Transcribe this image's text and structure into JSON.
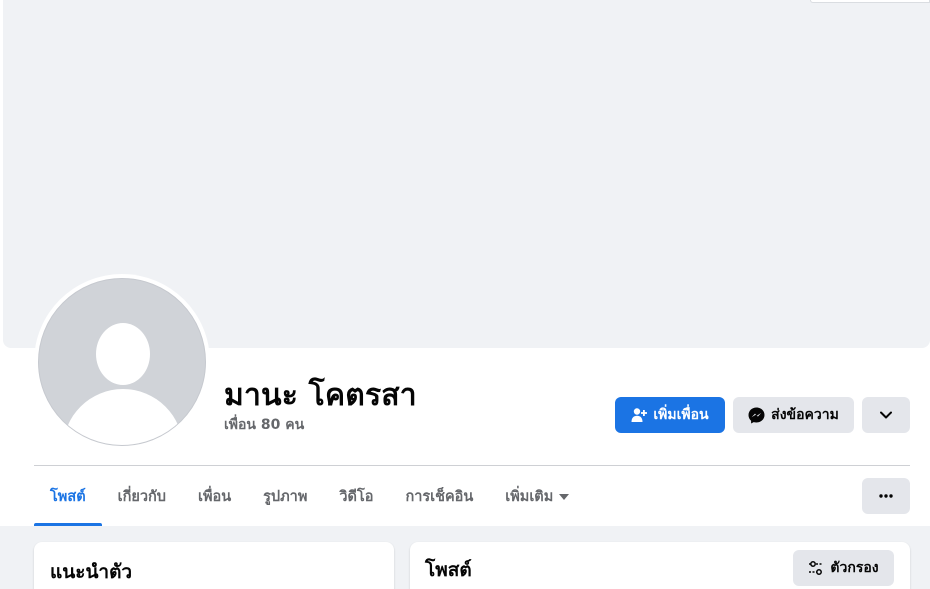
{
  "profile": {
    "name": "มานะ โคตรสา",
    "friends_count": "เพื่อน 80 คน"
  },
  "actions": {
    "add_friend": "เพิ่มเพื่อน",
    "message": "ส่งข้อความ"
  },
  "tabs": [
    {
      "label": "โพสต์"
    },
    {
      "label": "เกี่ยวกับ"
    },
    {
      "label": "เพื่อน"
    },
    {
      "label": "รูปภาพ"
    },
    {
      "label": "วิดีโอ"
    },
    {
      "label": "การเช็คอิน"
    },
    {
      "label": "เพิ่มเติม"
    }
  ],
  "intro": {
    "title": "แนะนำตัว"
  },
  "posts": {
    "title": "โพสต์",
    "filter_label": "ตัวกรอง"
  },
  "colors": {
    "accent": "#1b74e4",
    "secondary_button": "#e4e6eb",
    "muted_text": "#65676b"
  }
}
